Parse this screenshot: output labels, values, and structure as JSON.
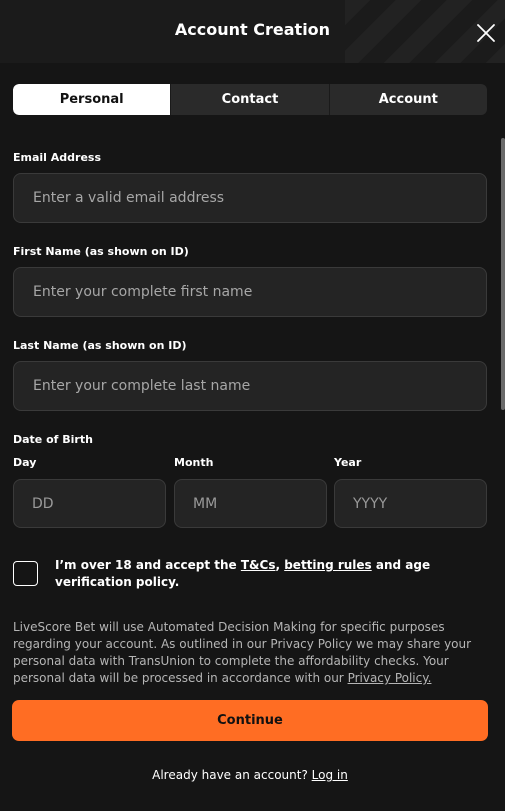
{
  "header": {
    "title": "Account Creation",
    "close_icon": "close-icon"
  },
  "tabs": [
    {
      "label": "Personal",
      "active": true
    },
    {
      "label": "Contact",
      "active": false
    },
    {
      "label": "Account",
      "active": false
    }
  ],
  "form": {
    "email": {
      "label": "Email Address",
      "placeholder": "Enter a valid email address",
      "value": ""
    },
    "first_name": {
      "label": "First Name (as shown on ID)",
      "placeholder": "Enter your complete first name",
      "value": ""
    },
    "last_name": {
      "label": "Last Name (as shown on ID)",
      "placeholder": "Enter your complete last name",
      "value": ""
    },
    "dob": {
      "label": "Date of Birth",
      "day": {
        "label": "Day",
        "placeholder": "DD"
      },
      "month": {
        "label": "Month",
        "placeholder": "MM"
      },
      "year": {
        "label": "Year",
        "placeholder": "YYYY"
      }
    }
  },
  "consent": {
    "checked": false,
    "text_before": "I’m over 18 and accept the ",
    "tcs_link": "T&Cs",
    "comma": ", ",
    "betting_rules_link": "betting rules",
    "text_after": " and age verification policy."
  },
  "info": {
    "text": "LiveScore Bet will use Automated Decision Making for specific purposes regarding your account. As outlined in our Privacy Policy we may share your personal data with TransUnion to complete the affordability checks. Your personal data will be processed in accordance with our ",
    "privacy_link": "Privacy Policy."
  },
  "actions": {
    "continue_label": "Continue",
    "login_prompt": "Already have an account? ",
    "login_link": "Log in"
  },
  "colors": {
    "accent": "#ff6d23",
    "background": "#151515",
    "input_bg": "#242424"
  }
}
